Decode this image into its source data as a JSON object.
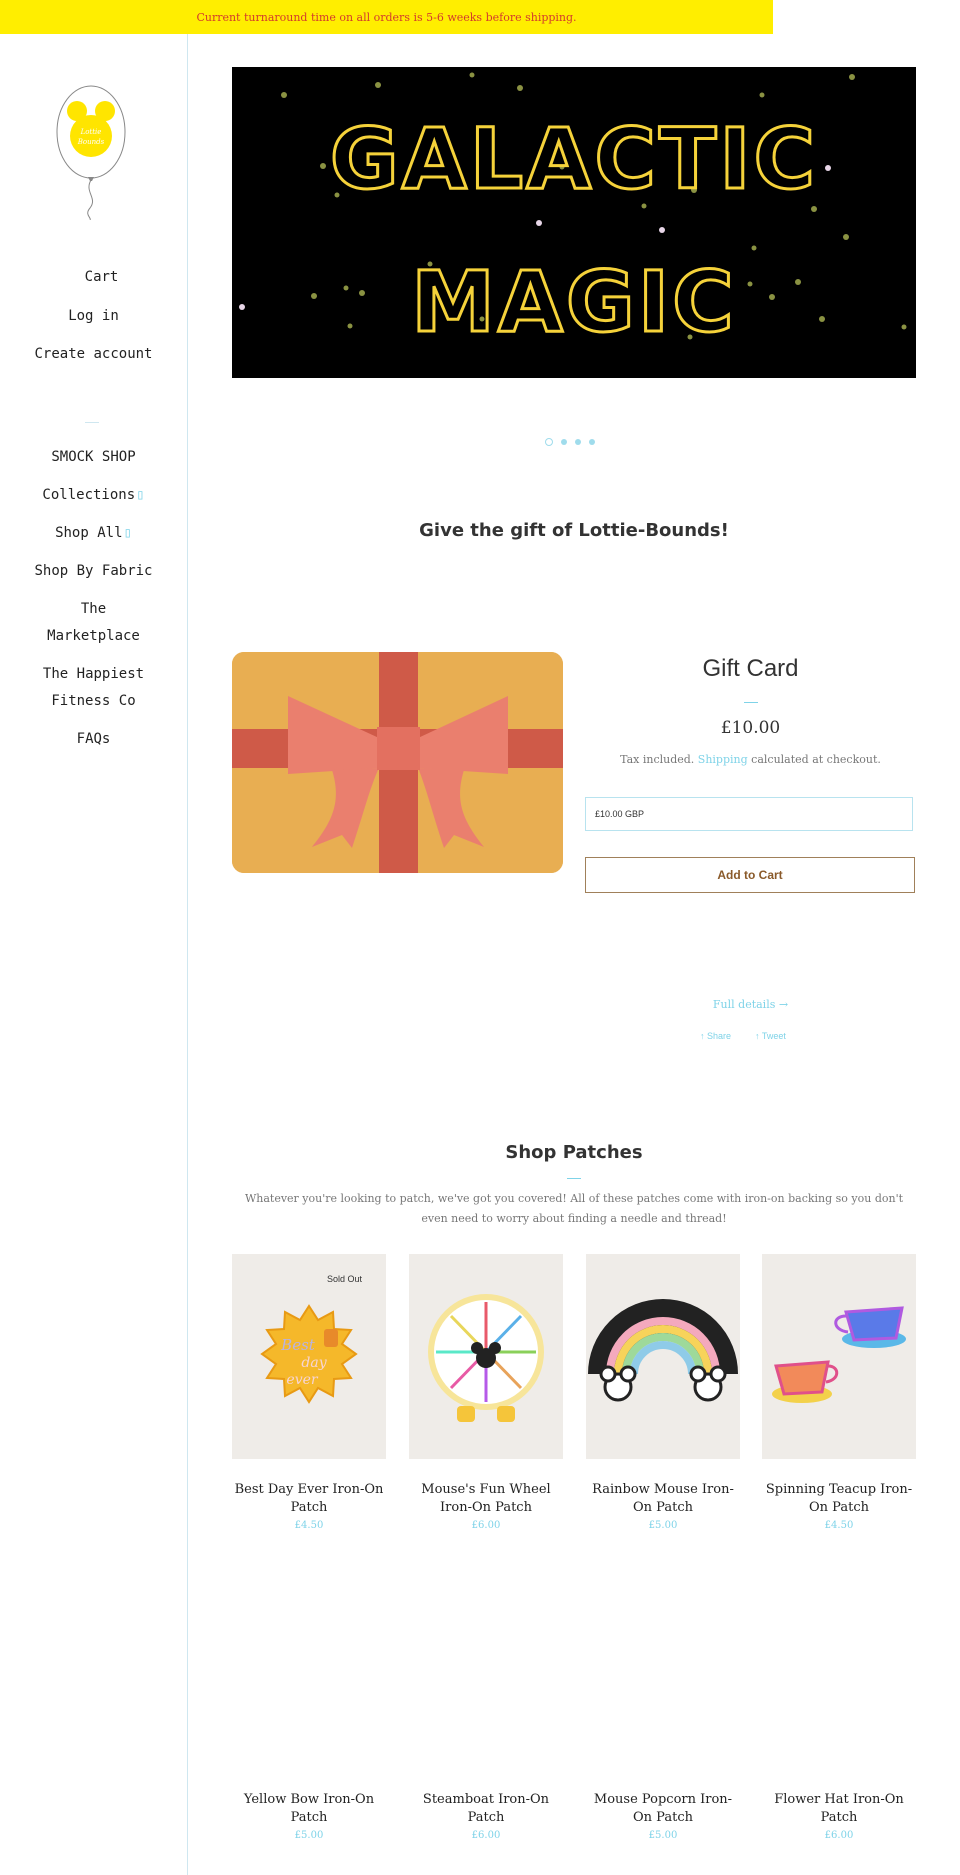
{
  "announcement": "Current turnaround time on all orders is 5-6 weeks before shipping.",
  "logo": {
    "line1": "Lottie",
    "line2": "Bounds"
  },
  "account_nav": [
    "Cart",
    "Log in",
    "Create account"
  ],
  "main_nav": {
    "smock": "SMOCK SHOP",
    "collections": "Collections",
    "shop_all": "Shop All",
    "by_fabric": "Shop By Fabric",
    "marketplace_1": "The",
    "marketplace_2": "Marketplace",
    "happiest_1": "The Happiest",
    "happiest_2": "Fitness Co",
    "faqs": "FAQs"
  },
  "hero": {
    "line1": "GALACTIC",
    "line2": "MAGIC"
  },
  "slider": {
    "count": 4,
    "active": 0
  },
  "gift_section": {
    "heading": "Give the gift of Lottie-Bounds!",
    "title": "Gift Card",
    "price": "£10.00",
    "tax_prefix": "Tax included.",
    "tax_link": "Shipping",
    "tax_suffix": "calculated at checkout.",
    "select_value": "£10.00 GBP",
    "add_to_cart": "Add to Cart",
    "full_details": "Full details →",
    "share": "↑ Share",
    "tweet": "↑ Tweet"
  },
  "patches": {
    "heading": "Shop Patches",
    "description": "Whatever you're looking to patch, we've got you covered! All of these patches come with iron-on backing so you don't even need to worry about finding a needle and thread!",
    "sold_out": "Sold Out",
    "row1": [
      {
        "name": "Best Day Ever Iron-On Patch",
        "price": "£4.50"
      },
      {
        "name": "Mouse's Fun Wheel Iron-On Patch",
        "price": "£6.00"
      },
      {
        "name": "Rainbow Mouse Iron-On Patch",
        "price": "£5.00"
      },
      {
        "name": "Spinning Teacup Iron-On Patch",
        "price": "£4.50"
      }
    ],
    "row2": [
      {
        "name": "Yellow Bow Iron-On Patch",
        "price": "£5.00"
      },
      {
        "name": "Steamboat Iron-On Patch",
        "price": "£6.00"
      },
      {
        "name": "Mouse Popcorn Iron-On Patch",
        "price": "£5.00"
      },
      {
        "name": "Flower Hat Iron-On Patch",
        "price": "£6.00"
      }
    ]
  },
  "colors": {
    "accent": "#7fd3e8",
    "announce_bg": "#ffee00",
    "announce_text": "#d33b2c",
    "hero_text": "#f5d23a"
  }
}
